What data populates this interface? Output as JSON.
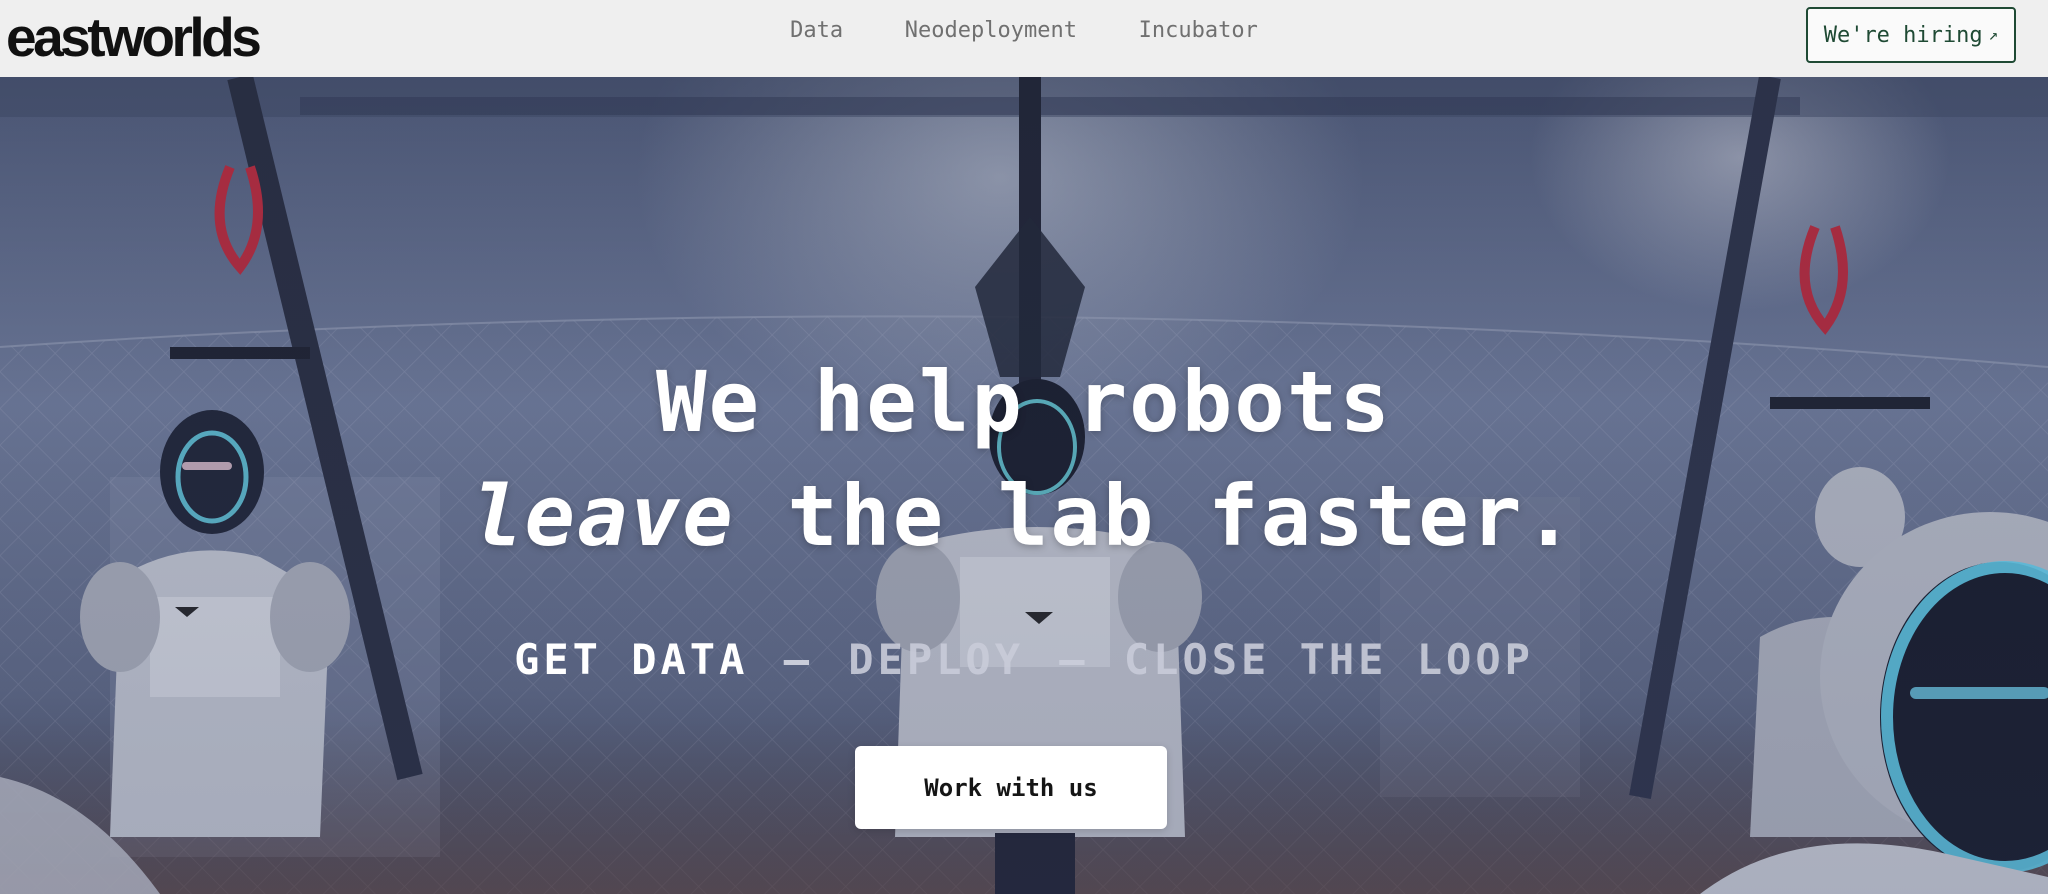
{
  "header": {
    "logo": "eastworlds",
    "nav": [
      "Data",
      "Neodeployment",
      "Incubator"
    ],
    "hire_label": "We're hiring",
    "hire_icon": "arrow-up-right-icon"
  },
  "hero": {
    "headline_line1": "We help robots",
    "headline_line2_em": "leave",
    "headline_line2_rest": " the lab faster.",
    "tagline": {
      "part1": "GET DATA",
      "sep": "–",
      "part2": "DEPLOY",
      "part3": "CLOSE THE LOOP"
    },
    "cta_label": "Work with us"
  },
  "colors": {
    "header_bg": "#efefef",
    "accent_green": "#1f4a34",
    "hero_tint": "#5d6a86"
  }
}
